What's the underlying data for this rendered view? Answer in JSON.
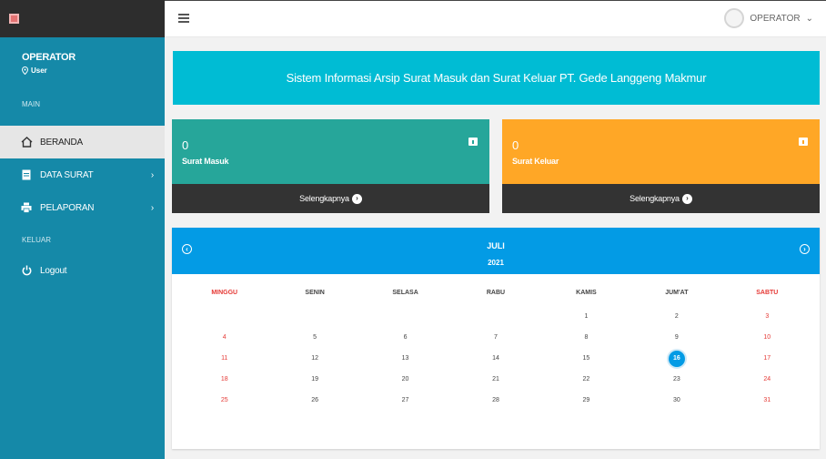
{
  "user": {
    "name": "OPERATOR",
    "role": "User"
  },
  "sidebar": {
    "section_main": "MAIN",
    "section_keluar": "KELUAR",
    "items": [
      {
        "label": "BERANDA",
        "icon": "home-icon",
        "active": true,
        "has_children": false
      },
      {
        "label": "DATA SURAT",
        "icon": "document-icon",
        "active": false,
        "has_children": true
      },
      {
        "label": "PELAPORAN",
        "icon": "printer-icon",
        "active": false,
        "has_children": true
      }
    ],
    "logout_label": "Logout"
  },
  "topbar": {
    "user_label": "OPERATOR"
  },
  "banner": {
    "title": "Sistem Informasi Arsip Surat Masuk dan Surat Keluar PT. Gede Langgeng Makmur"
  },
  "cards": [
    {
      "count": "0",
      "label": "Surat Masuk",
      "link": "Selengkapnya",
      "color": "#26a69a"
    },
    {
      "count": "0",
      "label": "Surat Keluar",
      "link": "Selengkapnya",
      "color": "#ffa726"
    }
  ],
  "calendar": {
    "month": "JULI",
    "year": "2021",
    "days_of_week": [
      "MINGGU",
      "SENIN",
      "SELASA",
      "RABU",
      "KAMIS",
      "JUM'AT",
      "SABTU"
    ],
    "weeks": [
      [
        "",
        "",
        "",
        "",
        "1",
        "2",
        "3"
      ],
      [
        "4",
        "5",
        "6",
        "7",
        "8",
        "9",
        "10"
      ],
      [
        "11",
        "12",
        "13",
        "14",
        "15",
        "16",
        "17"
      ],
      [
        "18",
        "19",
        "20",
        "21",
        "22",
        "23",
        "24"
      ],
      [
        "25",
        "26",
        "27",
        "28",
        "29",
        "30",
        "31"
      ]
    ],
    "today": "16",
    "weekend_color": "#e53935",
    "accent_color": "#039be5"
  }
}
